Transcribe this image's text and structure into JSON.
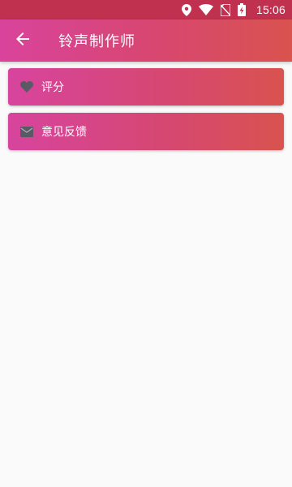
{
  "status_bar": {
    "time": "15:06",
    "icons": [
      "location-icon",
      "wifi-icon",
      "no-sim-icon",
      "battery-charging-icon"
    ],
    "background": "#c0304f"
  },
  "app_bar": {
    "title": "铃声制作师",
    "back_icon": "arrow-back-icon",
    "gradient": [
      "#d9439c",
      "#d9534f"
    ]
  },
  "menu": {
    "items": [
      {
        "label": "评分",
        "icon": "heart-icon"
      },
      {
        "label": "意见反馈",
        "icon": "mail-icon"
      }
    ]
  },
  "colors": {
    "icon_gray": "#5a5a66",
    "page_background": "#fafafa"
  }
}
